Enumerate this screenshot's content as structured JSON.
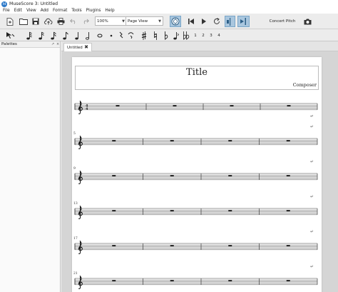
{
  "window": {
    "title": "MuseScore 3: Untitled",
    "logo": "M"
  },
  "menu": [
    "File",
    "Edit",
    "View",
    "Add",
    "Format",
    "Tools",
    "Plugins",
    "Help"
  ],
  "toolbar": {
    "zoom_value": "100%",
    "view_mode": "Page View",
    "concert_pitch_label": "Concert Pitch",
    "icons": [
      "new-file-icon",
      "open-folder-icon",
      "save-icon",
      "cloud-upload-icon",
      "print-icon",
      "undo-icon",
      "redo-icon",
      "mixer-icon",
      "rewind-icon",
      "play-icon",
      "loop-icon",
      "metronome-icon",
      "pan-score-icon",
      "camera-icon"
    ]
  },
  "note_input": {
    "voice_numbers": [
      "1",
      "2",
      "3",
      "4"
    ]
  },
  "palettes": {
    "title": "Palettes",
    "float_glyph": "↗",
    "close_glyph": "×"
  },
  "tabs": [
    {
      "label": "Untitled",
      "close_glyph": "✖"
    }
  ],
  "score": {
    "title": "Title",
    "composer": "Composer",
    "time_signature": {
      "top": "4",
      "bottom": "4"
    },
    "systems": [
      {
        "measure_number": ""
      },
      {
        "measure_number": "5"
      },
      {
        "measure_number": "9"
      },
      {
        "measure_number": "13"
      },
      {
        "measure_number": "17"
      },
      {
        "measure_number": "21"
      }
    ],
    "measures_per_system": 4,
    "line_break_glyph": "↵"
  },
  "colors": {
    "accent": "#2c79c9",
    "toggle_on": "#a9c6de"
  }
}
